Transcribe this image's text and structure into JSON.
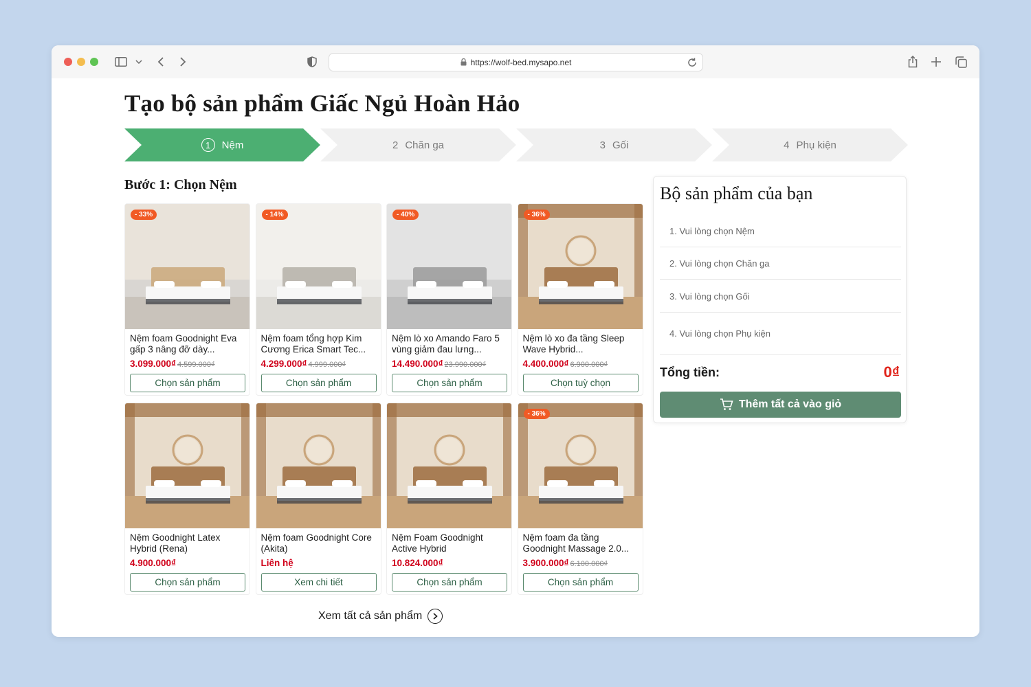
{
  "browser": {
    "url": "https://wolf-bed.mysapo.net"
  },
  "page": {
    "title": "Tạo bộ sản phẩm Giấc Ngủ Hoàn Hảo",
    "section_title": "Bước 1: Chọn Nệm",
    "view_all": "Xem tất cả sản phẩm"
  },
  "steps": [
    {
      "num": "1",
      "label": "Nệm",
      "active": true
    },
    {
      "num": "2",
      "label": "Chăn ga",
      "active": false
    },
    {
      "num": "3",
      "label": "Gối",
      "active": false
    },
    {
      "num": "4",
      "label": "Phụ kiện",
      "active": false
    }
  ],
  "products": [
    {
      "name": "Nệm foam Goodnight Eva gấp 3 nâng đỡ dày...",
      "price": "3.099.000₫",
      "old_price": "4.599.000₫",
      "badge": "- 33%",
      "button": "Chọn sản phẩm"
    },
    {
      "name": "Nệm foam tổng hợp Kim Cương Erica Smart Tec...",
      "price": "4.299.000₫",
      "old_price": "4.999.000₫",
      "badge": "- 14%",
      "button": "Chọn sản phẩm"
    },
    {
      "name": "Nệm lò xo Amando Faro 5 vùng giảm đau lưng...",
      "price": "14.490.000₫",
      "old_price": "23.990.000₫",
      "badge": "- 40%",
      "button": "Chọn sản phẩm"
    },
    {
      "name": "Nệm lò xo đa tầng Sleep Wave Hybrid...",
      "price": "4.400.000₫",
      "old_price": "6.900.000₫",
      "badge": "- 36%",
      "button": "Chọn tuỳ chọn"
    },
    {
      "name": "Nệm Goodnight Latex Hybrid (Rena)",
      "price": "4.900.000₫",
      "old_price": "",
      "badge": "",
      "button": "Chọn sản phẩm"
    },
    {
      "name": "Nệm foam Goodnight Core (Akita)",
      "price": "Liên hệ",
      "old_price": "",
      "badge": "",
      "button": "Xem chi tiết"
    },
    {
      "name": "Nệm Foam Goodnight Active Hybrid",
      "price": "10.824.000₫",
      "old_price": "",
      "badge": "",
      "button": "Chọn sản phẩm"
    },
    {
      "name": "Nệm foam đa tầng Goodnight Massage 2.0...",
      "price": "3.900.000₫",
      "old_price": "6.100.000₫",
      "badge": "- 36%",
      "button": "Chọn sản phẩm"
    }
  ],
  "summary": {
    "title": "Bộ sản phẩm của bạn",
    "items": [
      "1. Vui lòng chọn Nệm",
      "2. Vui lòng chọn Chăn ga",
      "3. Vui lòng chọn Gối",
      "4. Vui lòng chọn Phụ kiện"
    ],
    "total_label": "Tổng tiền:",
    "total_value": "0₫",
    "cart_button": "Thêm tất cả vào giỏ"
  },
  "colors": {
    "accent_green": "#4caf72",
    "button_green": "#5f8c73",
    "price_red": "#d0021b",
    "badge_orange": "#f15a24"
  }
}
